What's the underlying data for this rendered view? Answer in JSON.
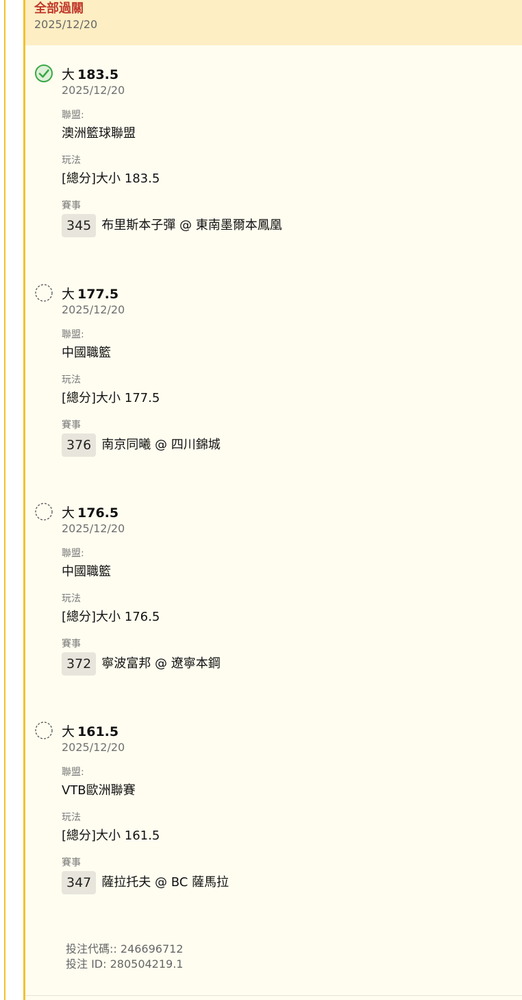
{
  "header": {
    "title": "全部過關",
    "date": "2025/12/20"
  },
  "legs": [
    {
      "status": "won",
      "status_icon": "check-circle-icon",
      "pick_label": "大",
      "pick_value": "183.5",
      "date": "2025/12/20",
      "league_label": "聯盟:",
      "league": "澳洲籃球聯盟",
      "market_label": "玩法",
      "market": "[總分]大小 183.5",
      "event_label": "賽事",
      "match_no": "345",
      "match": "布里斯本子彈 @ 東南墨爾本鳳凰"
    },
    {
      "status": "pending",
      "status_icon": "pending-circle-icon",
      "pick_label": "大",
      "pick_value": "177.5",
      "date": "2025/12/20",
      "league_label": "聯盟:",
      "league": "中國職籃",
      "market_label": "玩法",
      "market": "[總分]大小 177.5",
      "event_label": "賽事",
      "match_no": "376",
      "match": "南京同曦 @ 四川錦城"
    },
    {
      "status": "pending",
      "status_icon": "pending-circle-icon",
      "pick_label": "大",
      "pick_value": "176.5",
      "date": "2025/12/20",
      "league_label": "聯盟:",
      "league": "中國職籃",
      "market_label": "玩法",
      "market": "[總分]大小 176.5",
      "event_label": "賽事",
      "match_no": "372",
      "match": "寧波富邦 @ 遼寧本鋼"
    },
    {
      "status": "pending",
      "status_icon": "pending-circle-icon",
      "pick_label": "大",
      "pick_value": "161.5",
      "date": "2025/12/20",
      "league_label": "聯盟:",
      "league": "VTB歐洲聯賽",
      "market_label": "玩法",
      "market": "[總分]大小 161.5",
      "event_label": "賽事",
      "match_no": "347",
      "match": "薩拉托夫 @ BC 薩馬拉"
    }
  ],
  "footer": {
    "bet_code": "投注代碼:: 246696712",
    "bet_id": "投注 ID: 280504219.1"
  },
  "colors": {
    "accent": "#f1c232",
    "title_red": "#c0392b",
    "header_bg": "#fdeec4",
    "card_bg": "#fffdf0",
    "won_green": "#3aa845",
    "badge_bg": "#e8e5dc"
  }
}
